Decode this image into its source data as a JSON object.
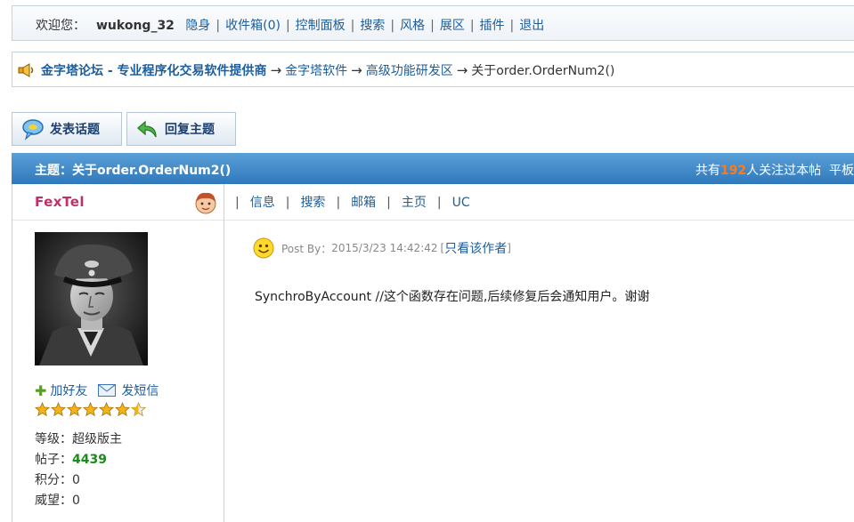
{
  "topbar": {
    "welcome": "欢迎您：",
    "username": "wukong_32",
    "links": [
      "隐身",
      "收件箱(0)",
      "控制面板",
      "搜索",
      "风格",
      "展区",
      "插件",
      "退出"
    ]
  },
  "breadcrumb": {
    "site": "金字塔论坛",
    "slogan": " - 专业程序化交易软件提供商",
    "arrow": "→",
    "items": [
      "金字塔软件",
      "高级功能研发区"
    ],
    "current": "关于order.OrderNum2()"
  },
  "buttons": {
    "new_topic": "发表话题",
    "reply": "回复主题"
  },
  "topic": {
    "title": "主题：关于order.OrderNum2()",
    "watch_prefix": "共有",
    "watch_count": "192",
    "watch_suffix": "人关注过本帖",
    "view_mode": "平板"
  },
  "author": {
    "name": "FexTel",
    "add_friend": "加好友",
    "send_msg": "发短信",
    "stars": 6.5,
    "level_label": "等级：",
    "level": "超级版主",
    "posts_label": "帖子：",
    "posts": "4439",
    "score_label": "积分：",
    "score": "0",
    "prestige_label": "威望：",
    "prestige": "0"
  },
  "user_nav": [
    "信息",
    "搜索",
    "邮箱",
    "主页",
    "UC"
  ],
  "post": {
    "meta_prefix": "Post By：",
    "date": "2015/3/23 14:42:42",
    "only_author": "只看该作者",
    "body": "SynchroByAccount  //这个函数存在问题,后续修复后会通知用户。谢谢"
  },
  "colors": {
    "link": "#1e5d9a",
    "header_bar": "#3a84c4",
    "username": "#c0306a",
    "watch_count": "#ff7a1a",
    "posts_count": "#1c8a1c"
  }
}
